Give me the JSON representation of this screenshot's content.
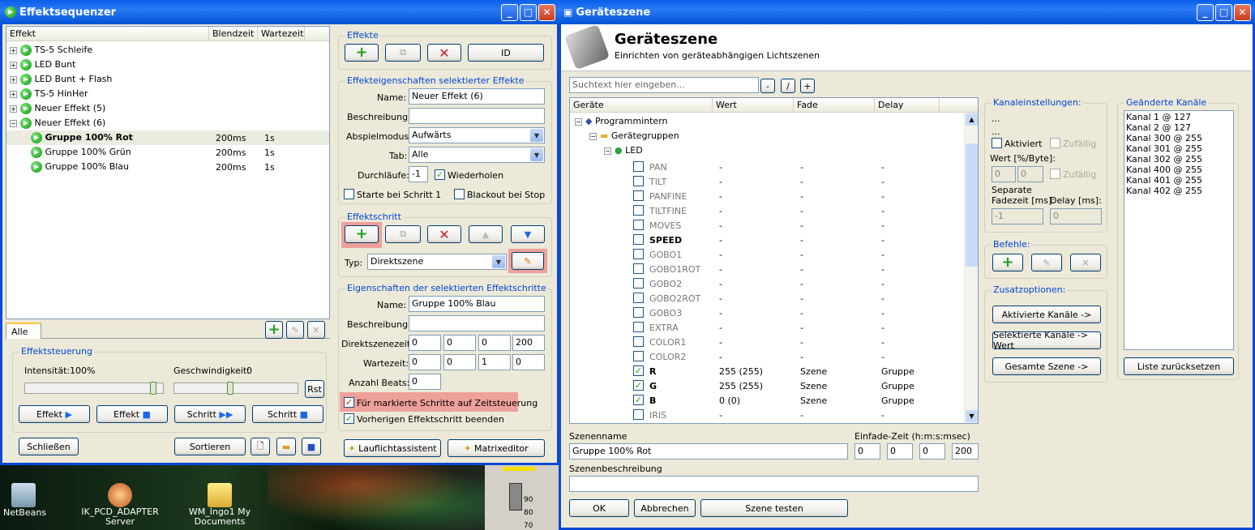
{
  "left_window": {
    "title": "Effektsequenzer",
    "tree_headers": [
      "Effekt",
      "Blendzeit",
      "Wartezeit"
    ],
    "tree_rows": [
      {
        "label": "TS-5 Schleife",
        "blend": "",
        "wait": ""
      },
      {
        "label": "LED Bunt",
        "blend": "",
        "wait": ""
      },
      {
        "label": "LED Bunt + Flash",
        "blend": "",
        "wait": ""
      },
      {
        "label": "TS-5 HinHer",
        "blend": "",
        "wait": ""
      },
      {
        "label": "Neuer Effekt (5)",
        "blend": "",
        "wait": ""
      },
      {
        "label": "Neuer Effekt (6)",
        "blend": "",
        "wait": ""
      },
      {
        "label": "Gruppe 100% Rot",
        "blend": "200ms",
        "wait": "1s"
      },
      {
        "label": "Gruppe 100% Grün",
        "blend": "200ms",
        "wait": "1s"
      },
      {
        "label": "Gruppe 100% Blau",
        "blend": "200ms",
        "wait": "1s"
      }
    ],
    "tab_alle": "Alle",
    "effektsteuerung": {
      "title": "Effektsteuerung",
      "intensity_label": "Intensität:",
      "intensity_value": "100%",
      "speed_label": "Geschwindigkeit:",
      "speed_value": "0",
      "intensity_level": 0.95,
      "speed_level": 0.45,
      "rst": "Rst",
      "btn_effekt_play": "Effekt",
      "btn_effekt_stop": "Effekt",
      "btn_schritt_next": "Schritt",
      "btn_schritt_stop": "Schritt"
    },
    "close": "Schließen",
    "sort": "Sortieren",
    "effekte": {
      "title": "Effekte",
      "id": "ID"
    },
    "props": {
      "title": "Effekteigenschaften selektierter Effekte",
      "name_label": "Name:",
      "name_value": "Neuer Effekt (6)",
      "desc_label": "Beschreibung:",
      "desc_value": "",
      "mode_label": "Abspielmodus:",
      "mode_value": "Aufwärts",
      "tab_label": "Tab:",
      "tab_value": "Alle",
      "runs_label": "Durchläufe:",
      "runs_value": "-1",
      "repeat": "Wiederholen",
      "start_step1": "Starte bei Schritt 1",
      "blackout": "Blackout bei Stop"
    },
    "schritt": {
      "title": "Effektschritt",
      "typ_label": "Typ:",
      "typ_value": "Direktszene"
    },
    "stepprops": {
      "title": "Eigenschaften der selektierten Effektschritte",
      "name_label": "Name:",
      "name_value": "Gruppe 100% Blau",
      "desc_label": "Beschreibung:",
      "desc_value": "",
      "direct_label": "Direktszenezeit:",
      "direct": [
        "0",
        "0",
        "0",
        "200"
      ],
      "wait_label": "Wartezeit:",
      "wait": [
        "0",
        "0",
        "1",
        "0"
      ],
      "beats_label": "Anzahl Beats:",
      "beats_value": "0",
      "timed": "Für markierte Schritte auf Zeitsteuerung",
      "prev": "Vorherigen Effektschritt beenden"
    },
    "lauflicht": "Lauflichtassistent",
    "matrix": "Matrixeditor"
  },
  "desktop": {
    "icons": [
      "NetBeans",
      "IK_PCD_ADAPTER Server",
      "WM_Ingo1 My Documents"
    ],
    "slider_ticks": [
      "90",
      "80",
      "70"
    ]
  },
  "right_window": {
    "title": "Geräteszene",
    "heading": "Geräteszene",
    "subheading": "Einrichten von geräteabhängigen Lichtszenen",
    "search_placeholder": "Suchtext hier eingeben...",
    "btn_minus": "-",
    "btn_slash": "/",
    "btn_plus": "+",
    "headers": [
      "Geräte",
      "Wert",
      "Fade",
      "Delay"
    ],
    "tree_nodes": [
      "Programmintern",
      "Gerätegruppen",
      "LED"
    ],
    "channels": [
      {
        "name": "PAN",
        "checked": false,
        "bold": false,
        "value": "-",
        "fade": "-",
        "delay": "-"
      },
      {
        "name": "TILT",
        "checked": false,
        "bold": false,
        "value": "-",
        "fade": "-",
        "delay": "-"
      },
      {
        "name": "PANFINE",
        "checked": false,
        "bold": false,
        "value": "-",
        "fade": "-",
        "delay": "-"
      },
      {
        "name": "TILTFINE",
        "checked": false,
        "bold": false,
        "value": "-",
        "fade": "-",
        "delay": "-"
      },
      {
        "name": "MOVES",
        "checked": false,
        "bold": false,
        "value": "-",
        "fade": "-",
        "delay": "-"
      },
      {
        "name": "SPEED",
        "checked": false,
        "bold": true,
        "value": "-",
        "fade": "-",
        "delay": "-"
      },
      {
        "name": "GOBO1",
        "checked": false,
        "bold": false,
        "value": "-",
        "fade": "-",
        "delay": "-"
      },
      {
        "name": "GOBO1ROT",
        "checked": false,
        "bold": false,
        "value": "-",
        "fade": "-",
        "delay": "-"
      },
      {
        "name": "GOBO2",
        "checked": false,
        "bold": false,
        "value": "-",
        "fade": "-",
        "delay": "-"
      },
      {
        "name": "GOBO2ROT",
        "checked": false,
        "bold": false,
        "value": "-",
        "fade": "-",
        "delay": "-"
      },
      {
        "name": "GOBO3",
        "checked": false,
        "bold": false,
        "value": "-",
        "fade": "-",
        "delay": "-"
      },
      {
        "name": "EXTRA",
        "checked": false,
        "bold": false,
        "value": "-",
        "fade": "-",
        "delay": "-"
      },
      {
        "name": "COLOR1",
        "checked": false,
        "bold": false,
        "value": "-",
        "fade": "-",
        "delay": "-"
      },
      {
        "name": "COLOR2",
        "checked": false,
        "bold": false,
        "value": "-",
        "fade": "-",
        "delay": "-"
      },
      {
        "name": "R",
        "checked": true,
        "bold": true,
        "value": "255 (255)",
        "fade": "Szene",
        "delay": "Gruppe"
      },
      {
        "name": "G",
        "checked": true,
        "bold": true,
        "value": "255 (255)",
        "fade": "Szene",
        "delay": "Gruppe"
      },
      {
        "name": "B",
        "checked": true,
        "bold": true,
        "value": "0 (0)",
        "fade": "Szene",
        "delay": "Gruppe"
      },
      {
        "name": "IRIS",
        "checked": false,
        "bold": false,
        "value": "-",
        "fade": "-",
        "delay": "-"
      }
    ],
    "kanal": {
      "title": "Kanaleinstellungen:",
      "dots1": "...",
      "dots2": "...",
      "aktiviert": "Aktiviert",
      "zufaellig1": "Zufällig",
      "wert_label": "Wert [%/Byte]:",
      "wert1": "0",
      "wert2": "0",
      "zufaellig2": "Zufällig",
      "separate": "Separate",
      "fade_label": "Fadezeit [ms]:",
      "delay_label": "Delay [ms]:",
      "fade_value": "-1",
      "delay_value": "0"
    },
    "befehle": {
      "title": "Befehle:"
    },
    "zusatz": {
      "title": "Zusatzoptionen:",
      "btn1": "Aktivierte Kanäle ->",
      "btn2": "Selektierte Kanäle -> Wert",
      "btn3": "Gesamte Szene ->"
    },
    "geaendert": {
      "title": "Geänderte Kanäle",
      "items": [
        "Kanal 1 @ 127",
        "Kanal 2 @ 127",
        "Kanal 300 @ 255",
        "Kanal 301 @ 255",
        "Kanal 302 @ 255",
        "Kanal 400 @ 255",
        "Kanal 401 @ 255",
        "Kanal 402 @ 255"
      ],
      "reset": "Liste zurücksetzen"
    },
    "scene_name_label": "Szenenname",
    "scene_name": "Gruppe 100% Rot",
    "einfade_label": "Einfade-Zeit (h:m:s:msec)",
    "einfade": [
      "0",
      "0",
      "0",
      "200"
    ],
    "scene_desc_label": "Szenenbeschreibung",
    "scene_desc": "",
    "ok": "OK",
    "cancel": "Abbrechen",
    "test": "Szene testen"
  }
}
